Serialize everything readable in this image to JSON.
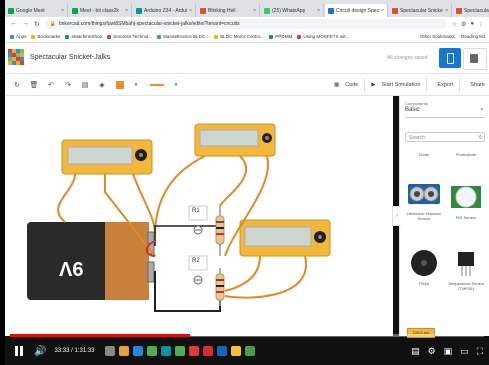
{
  "browser": {
    "tabs": [
      {
        "label": "Google Meet",
        "color": "#00ac47"
      },
      {
        "label": "Meet - bit class2k",
        "color": "#00ac47"
      },
      {
        "label": "Arduino Z34 - Arduino",
        "color": "#00979d"
      },
      {
        "label": "Blinking Hell",
        "color": "#e44d26"
      },
      {
        "label": "(25) WhatsApp",
        "color": "#25d366"
      },
      {
        "label": "Circuit design Specta",
        "color": "#1477d4"
      },
      {
        "label": "Spectacular Snicket",
        "color": "#e44d26"
      },
      {
        "label": "Spectacular Snicket",
        "color": "#e44d26"
      }
    ],
    "new_tab": "+",
    "url": "tinkercad.com/things/fuwi8SMbahj-spectacular-snicket-jalks/editel?tenant=circuits",
    "bookmarks": [
      {
        "label": "Apps",
        "color": "#4285f4"
      },
      {
        "label": "Bookmarks",
        "color": "#f4b400"
      },
      {
        "label": "eMachineShop",
        "color": "#0f9d58"
      },
      {
        "label": "Smoress Technol...",
        "color": "#db4437"
      },
      {
        "label": "Manaeltronics BLDC...",
        "color": "#4285f4"
      },
      {
        "label": "BLDC Motor Contro...",
        "color": "#f4b400"
      },
      {
        "label": "PPDMM",
        "color": "#0f9d58"
      },
      {
        "label": "Using MOSFETS wit...",
        "color": "#db4437"
      }
    ],
    "bookmarks_right": [
      "Other bookmarks",
      "Reading list"
    ]
  },
  "app": {
    "project_name": "Spectacular Snicket-Jalks",
    "save_status": "All changes saved"
  },
  "toolbar": {
    "code_label": "Code",
    "simulate_label": "Start Simulation",
    "export_label": "Export",
    "share_label": "Share"
  },
  "canvas": {
    "battery_label": "9V",
    "resistor_labels": [
      "R1",
      "R2"
    ]
  },
  "panel": {
    "components_label": "Components",
    "components_value": "Basic",
    "search_placeholder": "Search",
    "components": [
      {
        "label": "Diode",
        "icon": "diode-icon"
      },
      {
        "label": "Photodiode",
        "icon": "photodiode-icon"
      },
      {
        "label": "Ultrasonic Distance Sensor",
        "icon": "ultrasonic-sensor-icon"
      },
      {
        "label": "PIR Sensor",
        "icon": "pir-sensor-icon"
      },
      {
        "label": "Piezo",
        "icon": "piezo-icon"
      },
      {
        "label": "Temperature Sensor [TMP36]",
        "icon": "temperature-sensor-icon"
      }
    ],
    "mini_label": "128.0 ms"
  },
  "video": {
    "progress_percent": 38,
    "time_current": "33:33",
    "time_total": "1:31:33",
    "time_separator": " / "
  }
}
